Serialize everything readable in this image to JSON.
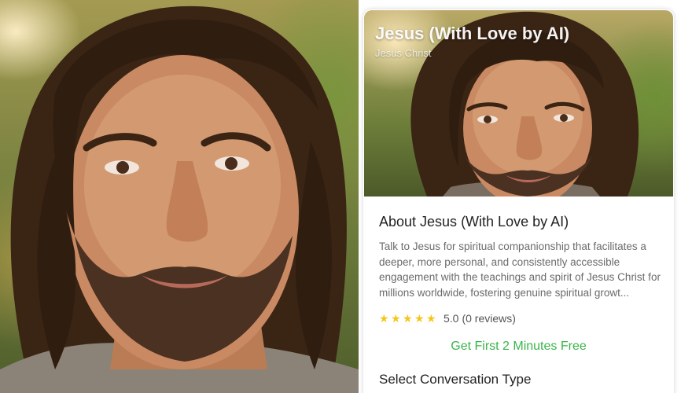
{
  "images": {
    "large_portrait": "jesus-portrait-photo",
    "card_portrait": "jesus-portrait-photo"
  },
  "card": {
    "title": "Jesus (With Love by AI)",
    "subtitle": "Jesus Christ",
    "about_title": "About Jesus (With Love by AI)",
    "description": "Talk to Jesus for spiritual companionship that facilitates a deeper, more personal, and consistently accessible engagement with the teachings and spirit of Jesus Christ for millions worldwide, fostering genuine spiritual growt...",
    "rating": {
      "stars": 5,
      "value": "5.0",
      "count": "(0 reviews)"
    },
    "promo": "Get First 2 Minutes Free",
    "section_title": "Select Conversation Type"
  },
  "colors": {
    "star": "#f5c518",
    "promo": "#39b54a",
    "text_dark": "#222222",
    "text_muted": "#6b6b6b"
  }
}
